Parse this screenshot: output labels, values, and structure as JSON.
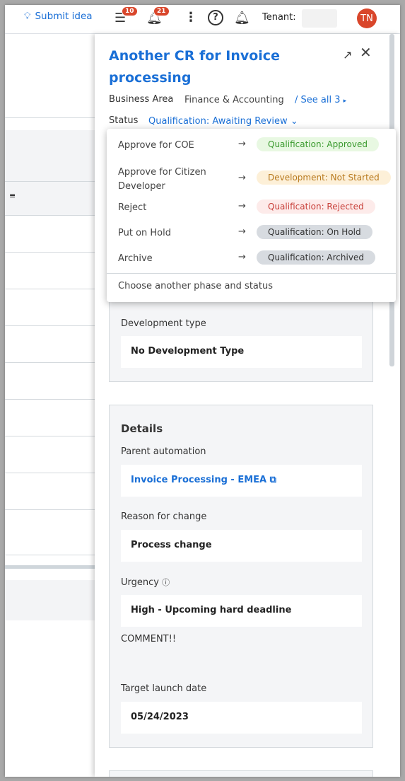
{
  "topbar": {
    "submit_idea": "Submit idea",
    "tasks_count": "10",
    "notifications_count": "21",
    "tenant_label": "Tenant:",
    "avatar_initials": "TN"
  },
  "panel": {
    "title": "Another CR for Invoice processing",
    "business_area_label": "Business Area",
    "business_area_value": "Finance & Accounting",
    "see_all": "/ See all 3",
    "status_label": "Status",
    "status_value": "Qualification: Awaiting Review"
  },
  "status_menu": {
    "options": [
      {
        "action": "Approve for COE",
        "target": "Qualification: Approved",
        "color": "#3a9a2e",
        "bg": "#e8f8e2"
      },
      {
        "action": "Approve for Citizen Developer",
        "target": "Development: Not Started",
        "color": "#b8791d",
        "bg": "#fdf0d8"
      },
      {
        "action": "Reject",
        "target": "Qualification: Rejected",
        "color": "#c8403a",
        "bg": "#fdebea"
      },
      {
        "action": "Put on Hold",
        "target": "Qualification: On Hold",
        "color": "#333",
        "bg": "#d7dbe0"
      },
      {
        "action": "Archive",
        "target": "Qualification: Archived",
        "color": "#333",
        "bg": "#d7dbe0"
      }
    ],
    "other": "Choose another phase and status"
  },
  "dev_card": {
    "label": "Development type",
    "value": "No Development Type"
  },
  "details": {
    "heading": "Details",
    "parent_label": "Parent automation",
    "parent_value": "Invoice Processing - EMEA",
    "reason_label": "Reason for change",
    "reason_value": "Process change",
    "urgency_label": "Urgency",
    "urgency_value": "High - Upcoming hard deadline",
    "comment": "COMMENT!!",
    "launch_label": "Target launch date",
    "launch_value": "05/24/2023"
  }
}
